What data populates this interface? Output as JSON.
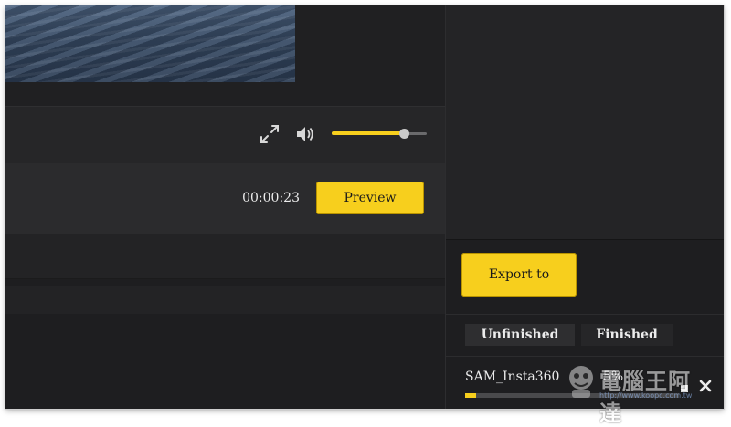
{
  "player": {
    "timecode": "00:00:23",
    "preview_label": "Preview",
    "volume_level": 0.76
  },
  "export": {
    "export_label": "Export to"
  },
  "queue": {
    "tabs": [
      {
        "label": "Unfinished",
        "active": true
      },
      {
        "label": "Finished",
        "active": false
      }
    ],
    "task": {
      "name": "SAM_Insta360",
      "percent": "5%",
      "progress": 0.05
    }
  },
  "watermark": {
    "text": "電腦王阿達",
    "url": "http://www.koopc.com.tw"
  },
  "colors": {
    "accent": "#f7cf1d",
    "background": "#1c1c1e"
  },
  "icons": {
    "fullscreen": "fullscreen-icon",
    "volume": "volume-icon",
    "pause": "pause-icon",
    "close": "close-icon"
  }
}
